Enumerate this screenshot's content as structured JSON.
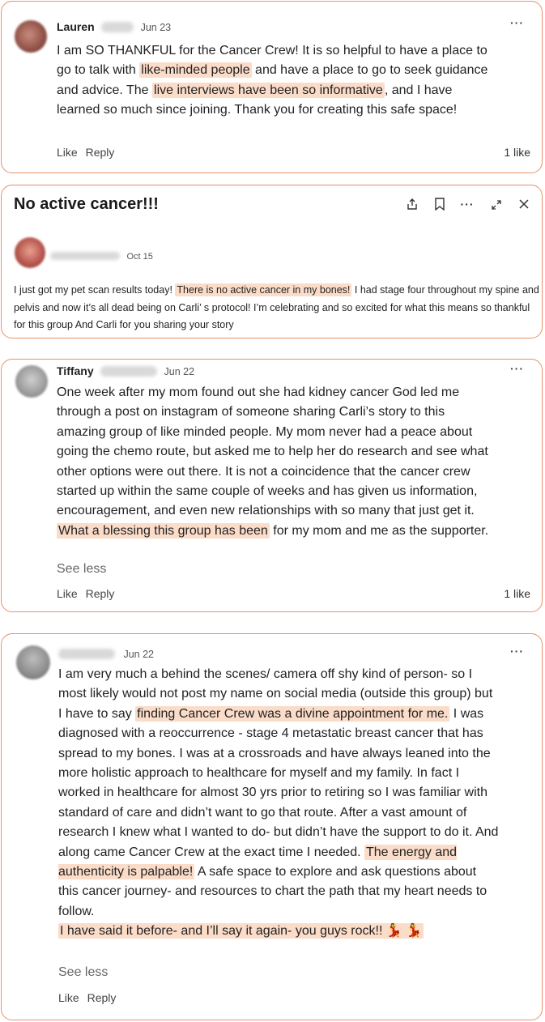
{
  "comment1": {
    "author": "Lauren",
    "date": "Jun 23",
    "text_parts": [
      "I am SO THANKFUL for the Cancer Crew! It is so helpful to have a place to go to talk with ",
      "like-minded people",
      " and have a place to go to seek guidance and advice. The ",
      "live interviews have been so informative",
      ", and I have learned so much since joining. Thank you for creating this safe space!"
    ],
    "like_label": "Like",
    "reply_label": "Reply",
    "likes": "1 like"
  },
  "post": {
    "title": "No active cancer!!!",
    "date": "Oct 15",
    "text_parts": [
      "I just got my pet scan results today! ",
      "There is no active cancer in my bones!",
      " I had stage four throughout my spine and pelvis and now it’s all dead being on Carli’ s protocol! I’m celebrating and so excited for what this means so thankful for this group And Carli for you sharing your story"
    ]
  },
  "comment2": {
    "author": "Tiffany",
    "date": "Jun 22",
    "text_parts": [
      "One week after my mom found out she had kidney cancer God led me through a post on instagram of someone sharing Carli’s story to this amazing group of like minded people. My mom never had a peace about going the chemo route, but asked me to help her do research and see what other options were out there. It is not a coincidence that the cancer crew started up within the same couple of weeks and has given us information, encouragement, and even new relationships with so many that just get it. ",
      "What a blessing this group has been",
      " for my mom and me as the supporter."
    ],
    "see_less": "See less",
    "like_label": "Like",
    "reply_label": "Reply",
    "likes": "1 like"
  },
  "comment3": {
    "date": "Jun 22",
    "text_parts": [
      "I am very much a behind the scenes/ camera off shy kind of person- so I most likely would not post my name on social media (outside this group) but I have to say ",
      "finding Cancer Crew was a divine appointment for me.",
      " I was diagnosed with a reoccurrence - stage 4 metastatic breast cancer that has spread to my bones. I was at a crossroads and have always leaned into the more holistic approach to healthcare for myself and my family. In fact I worked in healthcare for almost 30 yrs prior to retiring so I was familiar with standard of care and didn’t want to go that route. After a vast amount of research I knew what I wanted to do- but didn’t have the support to do it. And along came Cancer Crew at the exact time I needed. ",
      "The energy and authenticity is palpable!",
      " A safe space to explore and ask questions about this cancer journey- and resources to chart the path that my heart needs to follow.",
      "I have said it before- and I’ll say it again- you guys rock!! 💃 💃"
    ],
    "see_less": "See less",
    "like_label": "Like",
    "reply_label": "Reply"
  },
  "colors": {
    "border": "#e8916b",
    "highlight": "#fbdcc9"
  }
}
